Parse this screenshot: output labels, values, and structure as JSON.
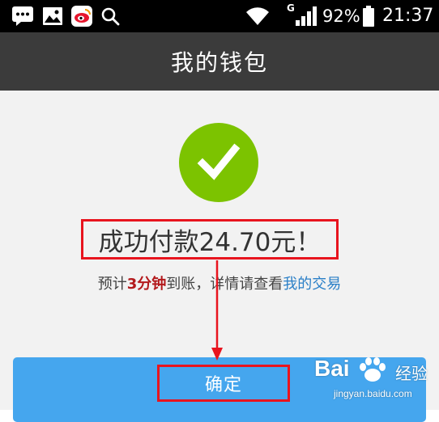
{
  "status_bar": {
    "icons": [
      "chat-notification-icon",
      "gallery-icon",
      "sina-weibo-icon",
      "search-icon",
      "wifi-icon",
      "signal-icon",
      "battery-icon"
    ],
    "network_type": "G",
    "battery_percent": "92%",
    "time": "21:37"
  },
  "app_bar": {
    "title": "我的钱包"
  },
  "result": {
    "headline": "成功付款24.70元！",
    "subline": {
      "prefix": "预计",
      "duration": "3分钟",
      "middle": "到账，详情请查看",
      "link": "我的交易"
    }
  },
  "confirm_button": {
    "label": "确定"
  },
  "colors": {
    "status_bar_bg": "#000000",
    "app_bar_bg": "#3b3b3b",
    "content_bg": "#f2f2f2",
    "success_green": "#7cc300",
    "button_blue": "#45a6ee",
    "highlight_red": "#b3191c",
    "link_blue": "#2a7fc7",
    "annotation_red": "#e8141e"
  },
  "watermark": {
    "brand": "Bai",
    "brand_cn": "经验",
    "url": "jingyan.baidu.com"
  }
}
